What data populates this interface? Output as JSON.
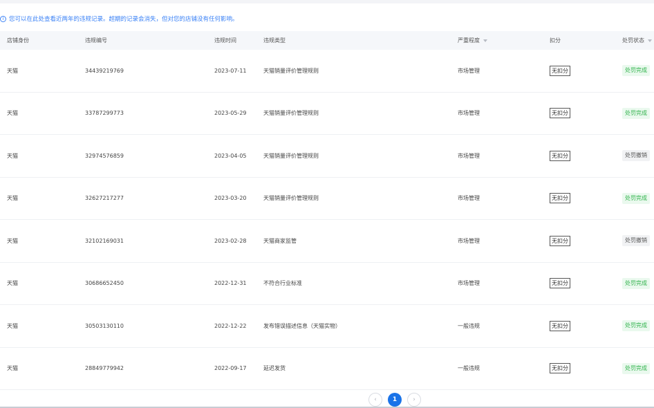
{
  "notice": "您可以在此处查看近两年的违规记录。超期的记录会消失，但对您的店铺没有任何影响。",
  "columns": [
    "店铺身份",
    "违规编号",
    "违规时间",
    "违规类型",
    "严重程度",
    "扣分",
    "处罚状态"
  ],
  "rows": [
    {
      "shop": "天猫",
      "id": "34439219769",
      "date": "2023-07-11",
      "type": "天猫销量评价管理规则",
      "severity": "市场管理",
      "deduct": "无扣分",
      "status": "处罚完成",
      "status_kind": "done"
    },
    {
      "shop": "天猫",
      "id": "33787299773",
      "date": "2023-05-29",
      "type": "天猫销量评价管理规则",
      "severity": "市场管理",
      "deduct": "无扣分",
      "status": "处罚完成",
      "status_kind": "done"
    },
    {
      "shop": "天猫",
      "id": "32974576859",
      "date": "2023-04-05",
      "type": "天猫销量评价管理规则",
      "severity": "市场管理",
      "deduct": "无扣分",
      "status": "处罚撤销",
      "status_kind": "revoked"
    },
    {
      "shop": "天猫",
      "id": "32627217277",
      "date": "2023-03-20",
      "type": "天猫销量评价管理规则",
      "severity": "市场管理",
      "deduct": "无扣分",
      "status": "处罚完成",
      "status_kind": "done"
    },
    {
      "shop": "天猫",
      "id": "32102169031",
      "date": "2023-02-28",
      "type": "天猫商家监管",
      "severity": "市场管理",
      "deduct": "无扣分",
      "status": "处罚撤销",
      "status_kind": "revoked"
    },
    {
      "shop": "天猫",
      "id": "30686652450",
      "date": "2022-12-31",
      "type": "不符合行业标准",
      "severity": "市场管理",
      "deduct": "无扣分",
      "status": "处罚完成",
      "status_kind": "done"
    },
    {
      "shop": "天猫",
      "id": "30503130110",
      "date": "2022-12-22",
      "type": "发布错误描述信息（天猫实物）",
      "severity": "一般违规",
      "deduct": "无扣分",
      "status": "处罚完成",
      "status_kind": "done"
    },
    {
      "shop": "天猫",
      "id": "28849779942",
      "date": "2022-09-17",
      "type": "延迟发货",
      "severity": "一般违规",
      "deduct": "无扣分",
      "status": "处罚完成",
      "status_kind": "done"
    }
  ],
  "pagination": {
    "current": "1",
    "prev": "‹",
    "next": "›"
  },
  "colors": {
    "accent": "#1a73e8",
    "done": "#2fb24a"
  }
}
